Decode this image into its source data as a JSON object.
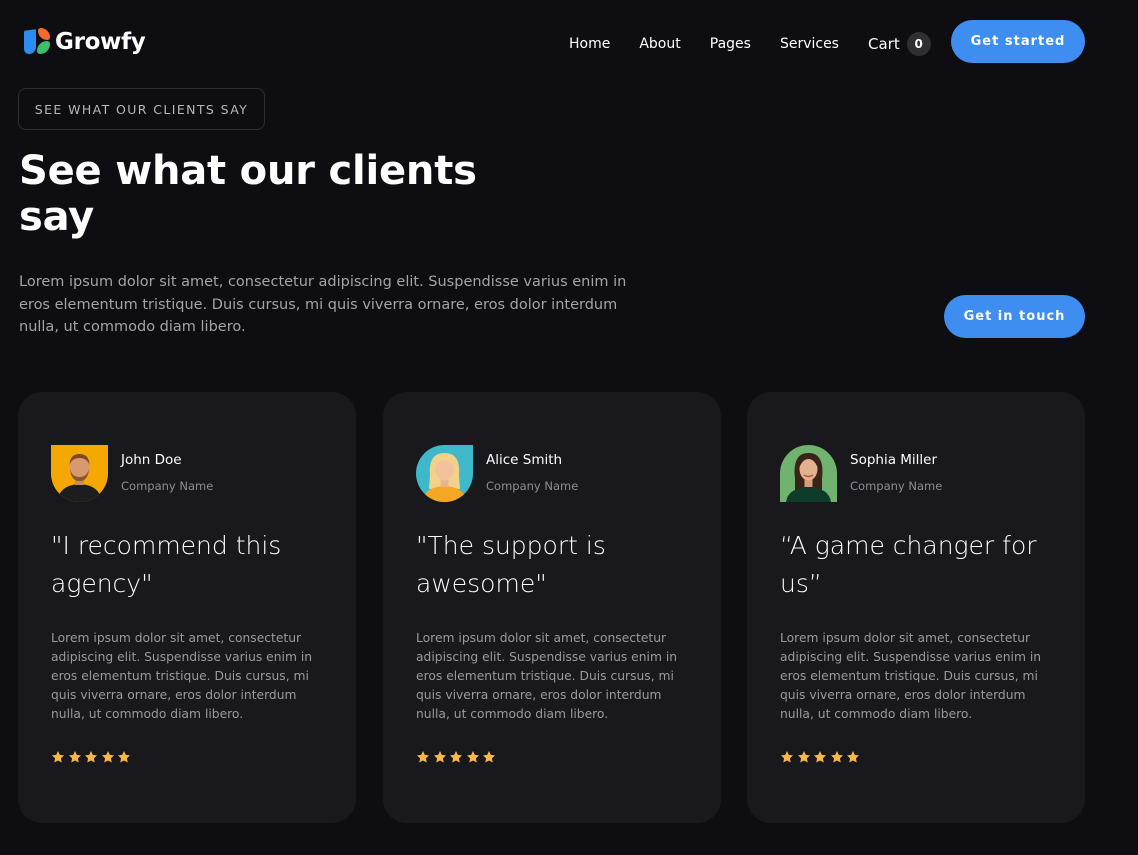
{
  "brand": {
    "name": "Growfy",
    "colors": {
      "blue": "#2d8cf0",
      "orange": "#f36b2c",
      "green": "#3bbf6a"
    }
  },
  "nav": {
    "links": [
      "Home",
      "About",
      "Pages",
      "Services"
    ],
    "cart_label": "Cart",
    "cart_count": "0",
    "cta_label": "Get started"
  },
  "hero": {
    "eyebrow": "SEE WHAT OUR CLIENTS SAY",
    "title": "See what our clients say",
    "description": "Lorem ipsum dolor sit amet, consectetur adipiscing elit. Suspendisse varius enim in eros elementum tristique. Duis cursus, mi quis viverra ornare, eros dolor interdum nulla, ut commodo diam libero.",
    "cta_label": "Get in touch"
  },
  "testimonials": [
    {
      "name": "John Doe",
      "company": "Company Name",
      "quote": "\"I recommend this agency\"",
      "body": "Lorem ipsum dolor sit amet, consectetur adipiscing elit. Suspendisse varius enim in eros elementum tristique. Duis cursus, mi quis viverra ornare, eros dolor interdum nulla, ut commodo diam libero.",
      "rating": 5,
      "avatar_icon": "man-portrait-icon",
      "avatar_bg": "#f5a800"
    },
    {
      "name": "Alice Smith",
      "company": "Company Name",
      "quote": "\"The support is awesome\"",
      "body": "Lorem ipsum dolor sit amet, consectetur adipiscing elit. Suspendisse varius enim in eros elementum tristique. Duis cursus, mi quis viverra ornare, eros dolor interdum nulla, ut commodo diam libero.",
      "rating": 5,
      "avatar_icon": "woman-portrait-icon",
      "avatar_bg": "#3fb8c9"
    },
    {
      "name": "Sophia Miller",
      "company": "Company Name",
      "quote": "“A game changer for us”",
      "body": "Lorem ipsum dolor sit amet, consectetur adipiscing elit. Suspendisse varius enim in eros elementum tristique. Duis cursus, mi quis viverra ornare, eros dolor interdum nulla, ut commodo diam libero.",
      "rating": 5,
      "avatar_icon": "woman-portrait-icon",
      "avatar_bg": "#6fb36f"
    }
  ],
  "colors": {
    "accent": "#3d8ef0",
    "star": "#f7b84b",
    "card_bg": "#19181d",
    "page_bg": "#0e0d12"
  }
}
